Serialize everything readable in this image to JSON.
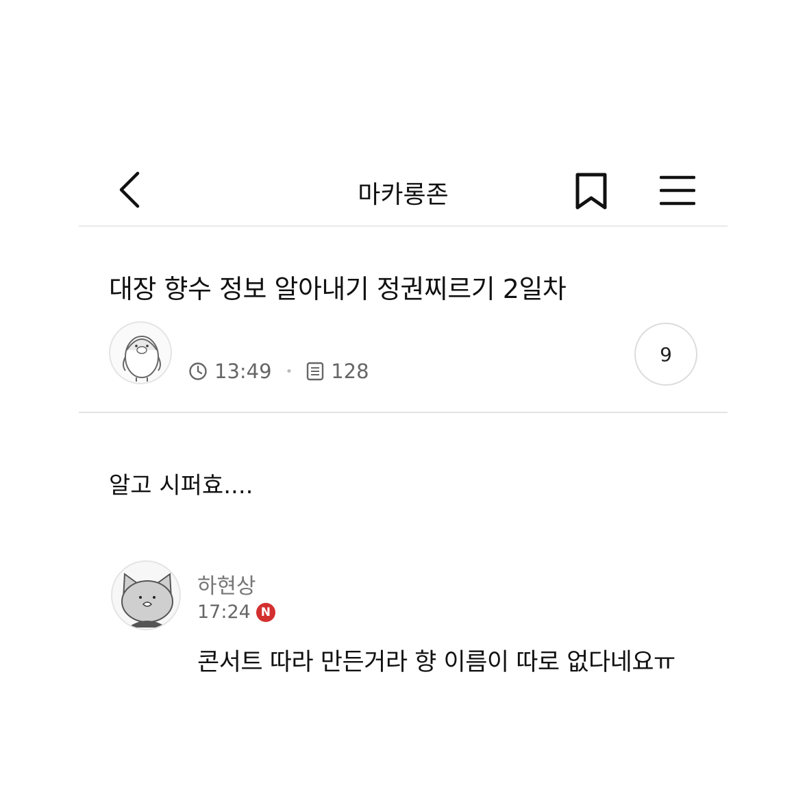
{
  "topbar": {
    "board_title": "마카롱존",
    "back_icon": "chevron-left-icon",
    "bookmark_icon": "bookmark-icon",
    "menu_icon": "hamburger-menu-icon"
  },
  "post": {
    "title": "대장 향수 정보 알아내기 정권찌르기 2일차",
    "time": "13:49",
    "views": "128",
    "comment_count": "9",
    "body": "알고 시퍼효...."
  },
  "comment": {
    "author": "하현상",
    "time": "17:24",
    "new_badge": "N",
    "text": "콘서트 따라 만든거라 향 이름이 따로 없다네요ㅠ"
  },
  "colors": {
    "new_badge": "#d32f2f",
    "meta_text": "#666666",
    "divider": "#e6e6e6"
  }
}
